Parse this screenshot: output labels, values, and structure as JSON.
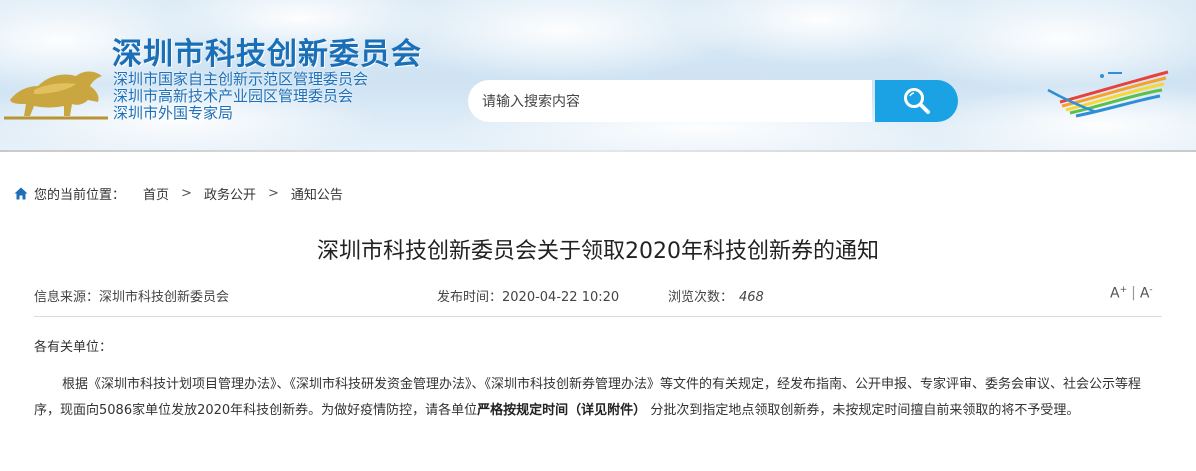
{
  "header": {
    "site_title": "深圳市科技创新委员会",
    "sub_titles": [
      "深圳市国家自主创新示范区管理委员会",
      "深圳市高新技术产业园区管理委员会",
      "深圳市外国专家局"
    ],
    "search": {
      "placeholder": "请输入搜索内容"
    },
    "colors": {
      "title": "#1a6fb6",
      "search_button": "#1aa2e4",
      "banner": "#d4e6f4"
    },
    "icons": {
      "search_button": "search-icon",
      "left_logo": "golden-bull-logo",
      "right_logo": "rainbow-city-logo"
    }
  },
  "breadcrumb": {
    "lead": "您的当前位置：",
    "items": [
      "首页",
      "政务公开",
      "通知公告"
    ],
    "separator": ">",
    "icon": "home-icon"
  },
  "article": {
    "title": "深圳市科技创新委员会关于领取2020年科技创新券的通知",
    "source_label": "信息来源：",
    "source": "深圳市科技创新委员会",
    "date_label": "发布时间：",
    "date": "2020-04-22 10:20",
    "views_label": "浏览次数：",
    "views": "468",
    "font_increase": "A",
    "font_decrease": "A",
    "font_increase_mark": "+",
    "font_decrease_mark": "-",
    "salutation": "各有关单位：",
    "para_1_part_1": "根据《深圳市科技计划项目管理办法》、《深圳市科技研发资金管理办法》、《深圳市科技创新券管理办法》等文件的有关规定，经发布指南、公开申报、专家评审、委务会审议、社会公示等程序，现面向5086家单位发放2020年科技创新券。为做好疫情防控，请各单位",
    "para_1_bold": "严格按规定时间（详见附件）",
    "para_1_part_2": "分批次到指定地点领取创新券，未按规定时间擅自前来领取的将不予受理。"
  }
}
